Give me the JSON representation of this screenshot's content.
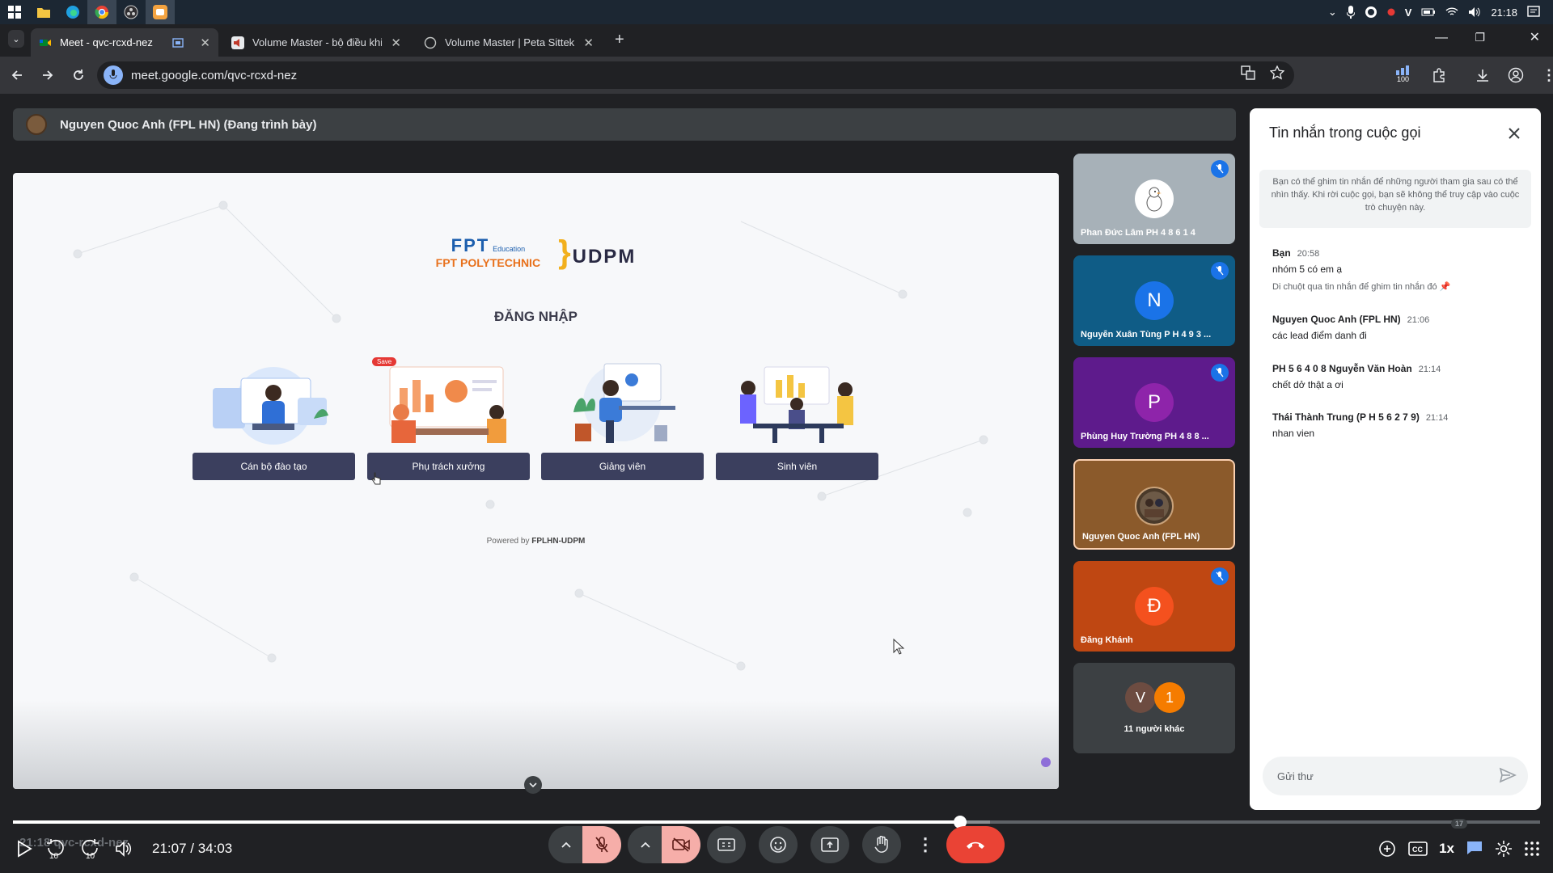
{
  "taskbar": {
    "time": "21:18"
  },
  "browser": {
    "tabs": [
      {
        "label": "Meet - qvc-rcxd-nez"
      },
      {
        "label": "Volume Master - bộ điều khiển"
      },
      {
        "label": "Volume Master | Peta Sittek"
      }
    ],
    "url": "meet.google.com/qvc-rcxd-nez",
    "extension_badge": "100"
  },
  "meet": {
    "presenter_label": "Nguyen Quoc Anh (FPL HN) (Đang trình bày)",
    "slide": {
      "logo_fpt": "FPT POLYTECHNIC",
      "logo_fpt_mark": "FPT",
      "logo_fpt_sub": "Education",
      "logo_udpm": "UDPM",
      "title": "ĐĂNG NHẬP",
      "roles": [
        {
          "label": "Cán bộ đào tạo"
        },
        {
          "label": "Phụ trách xưởng",
          "badge": "Save"
        },
        {
          "label": "Giảng viên"
        },
        {
          "label": "Sinh viên"
        }
      ],
      "powered_prefix": "Powered by",
      "powered_brand": "FPLHN-UDPM"
    },
    "participants": [
      {
        "name": "Phan Đức Lâm PH 4 8 6 1 4",
        "initial": "",
        "color": "#a3b0b8",
        "muted": true
      },
      {
        "name": "Nguyễn Xuân Tùng P H 4 9 3 ...",
        "initial": "N",
        "color": "#1a73e8",
        "bg": "#0f5f8c",
        "muted": true
      },
      {
        "name": "Phùng Huy Trường PH 4 8 8 ...",
        "initial": "P",
        "color": "#8e24aa",
        "bg": "#6a1b9a",
        "muted": true
      },
      {
        "name": "Nguyen Quoc Anh (FPL HN)",
        "initial": "",
        "color": "#7a5b3d",
        "bg": "#8b5a2b",
        "muted": false
      },
      {
        "name": "Đăng Khánh",
        "initial": "Đ",
        "color": "#f4511e",
        "bg": "#bf4a12",
        "muted": true
      }
    ],
    "others": {
      "label": "11 người khác",
      "initial_a": "V",
      "initial_b": "1"
    },
    "chat": {
      "title": "Tin nhắn trong cuộc gọi",
      "note": "Bạn có thể ghim tin nhắn để những người tham gia sau có thể nhìn thấy. Khi rời cuộc gọi, bạn sẽ không thể truy cập vào cuộc trò chuyện này.",
      "messages": [
        {
          "sender": "Bạn",
          "time": "20:58",
          "text": "nhóm 5 có em ạ",
          "hint": "Di chuột qua tin nhắn để ghim tin nhắn đó"
        },
        {
          "sender": "Nguyen Quoc Anh (FPL HN)",
          "time": "21:06",
          "text": "các lead điểm danh đi"
        },
        {
          "sender": "PH 5 6 4 0 8 Nguyễn Văn Hoàn",
          "time": "21:14",
          "text": "chết dở thật a ơi"
        },
        {
          "sender": "Thái Thành Trung (P H 5 6 2 7 9)",
          "time": "21:14",
          "text": "nhan vien"
        }
      ],
      "input_placeholder": "Gửi thư"
    }
  },
  "player": {
    "time_display": "21:07 / 34:03",
    "ghost_text": "21:18  qvc-rcxd-nez",
    "progress": 0.62,
    "buffered": 0.64,
    "skip_back": "10",
    "skip_forward": "10",
    "speed": "1x",
    "bubble_count": "17"
  },
  "colors": {
    "accent": "#1a73e8",
    "danger": "#ea4335",
    "slide_button": "#3b3f5e"
  }
}
